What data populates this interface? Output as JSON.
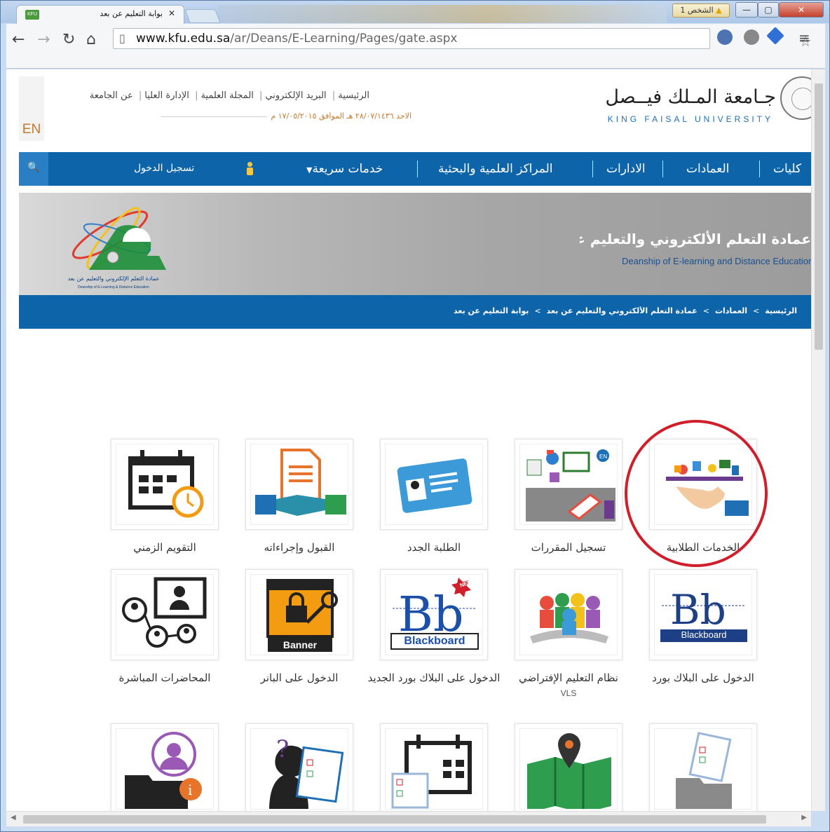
{
  "browser": {
    "tab_title": "بوابة التعليم عن بعد",
    "tab_favicon": "KFU",
    "profile_label": "الشخص 1",
    "url_host": "www.kfu.edu.sa",
    "url_path": "/ar/Deans/E-Learning/Pages/gate.aspx"
  },
  "header": {
    "lang_toggle": "EN",
    "top_links": [
      "الرئيسية",
      "البريد الإلكتروني",
      "المجلة العلمية",
      "الإدارة العليا",
      "عن الجامعة"
    ],
    "date_line": "الاحد   ٢٨/٠٧/١٤٣٦ هـ   الموافق   ١٧/٠٥/٢٠١٥ م",
    "university_name_ar": "جـامعة المـلك فيــصل",
    "university_name_en": "KING FAISAL UNIVERSITY"
  },
  "mainnav": {
    "items": [
      "كليات",
      "العمادات",
      "الادارات",
      "المراكز العلمية والبحثية",
      "خدمات سريعة"
    ],
    "login": "تسجيل الدخول"
  },
  "banner": {
    "title_ar": "عمادة التعلم الألكتروني والتعليم عن بعد",
    "title_en": "Deanship of E-learning and Distance Education",
    "logo_text_ar": "عمادة التعلم الإلكتروني والتعليم عن بعد",
    "logo_text_en": "Deanship of E-Learning & Distance Education"
  },
  "breadcrumb": {
    "items": [
      "الرئيسية",
      "العمادات",
      "عمادة التعلم الألكتروني والتعليم عن بعد",
      "بوابة التعليم عن بعد"
    ],
    "separator": ">"
  },
  "tiles": {
    "row1": [
      {
        "label": "الخدمات الطلابية"
      },
      {
        "label": "تسجيل المقررات"
      },
      {
        "label": "الطلبة الجدد"
      },
      {
        "label": "القبول وإجراءاته"
      },
      {
        "label": "التقويم الزمني"
      }
    ],
    "row2": [
      {
        "label": "الدخول على البلاك بورد",
        "logo": "Bb",
        "logo_text": "Blackboard"
      },
      {
        "label": "نظام التعليم الإفتراضي",
        "sub": "VLS"
      },
      {
        "label": "الدخول على البلاك بورد الجديد",
        "logo": "Bb",
        "logo_text": "Blackboard",
        "badge": "NEW"
      },
      {
        "label": "الدخول على البانر",
        "logo_text": "Banner"
      },
      {
        "label": "المحاضرات المباشرة"
      }
    ]
  },
  "colors": {
    "nav_blue": "#0e64a8",
    "accent_orange": "#c17a2e",
    "highlight_red": "#d01f2a"
  }
}
